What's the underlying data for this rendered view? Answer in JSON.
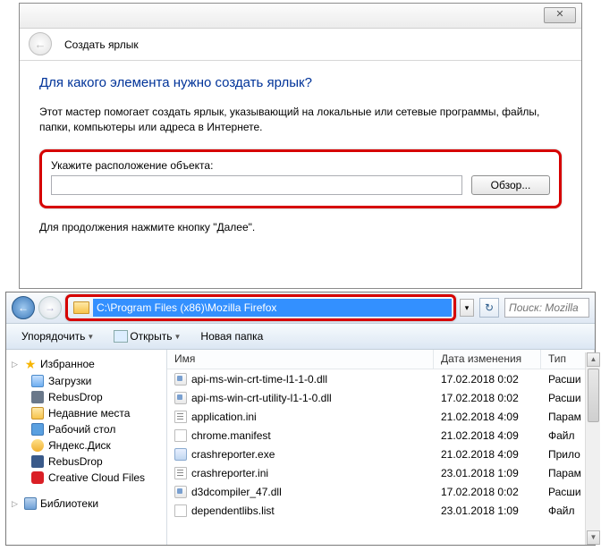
{
  "wizard": {
    "title": "Создать ярлык",
    "close": "✕",
    "question": "Для какого элемента нужно создать ярлык?",
    "description": "Этот мастер помогает создать ярлык, указывающий на локальные или сетевые программы, файлы, папки, компьютеры или адреса в Интернете.",
    "location_label": "Укажите расположение объекта:",
    "location_value": "",
    "browse": "Обзор...",
    "continue_hint": "Для продолжения нажмите кнопку \"Далее\"."
  },
  "explorer": {
    "address": "C:\\Program Files (x86)\\Mozilla Firefox",
    "search_placeholder": "Поиск: Mozilla",
    "toolbar": {
      "organize": "Упорядочить",
      "open": "Открыть",
      "new_folder": "Новая папка"
    },
    "sidebar": {
      "favorites": "Избранное",
      "items": [
        {
          "label": "Загрузки",
          "icon": "ic-dl"
        },
        {
          "label": "RebusDrop",
          "icon": "ic-rebus"
        },
        {
          "label": "Недавние места",
          "icon": "ic-recent"
        },
        {
          "label": "Рабочий стол",
          "icon": "ic-desk"
        },
        {
          "label": "Яндекс.Диск",
          "icon": "ic-yd"
        },
        {
          "label": "RebusDrop",
          "icon": "ic-rd"
        },
        {
          "label": "Creative Cloud Files",
          "icon": "ic-cc"
        }
      ],
      "libraries": "Библиотеки"
    },
    "columns": {
      "name": "Имя",
      "date": "Дата изменения",
      "type": "Тип"
    },
    "files": [
      {
        "name": "api-ms-win-crt-time-l1-1-0.dll",
        "date": "17.02.2018 0:02",
        "type": "Расши",
        "icon": "fic-dll"
      },
      {
        "name": "api-ms-win-crt-utility-l1-1-0.dll",
        "date": "17.02.2018 0:02",
        "type": "Расши",
        "icon": "fic-dll"
      },
      {
        "name": "application.ini",
        "date": "21.02.2018 4:09",
        "type": "Парам",
        "icon": "fic-ini"
      },
      {
        "name": "chrome.manifest",
        "date": "21.02.2018 4:09",
        "type": "Файл",
        "icon": "fic-man"
      },
      {
        "name": "crashreporter.exe",
        "date": "21.02.2018 4:09",
        "type": "Прило",
        "icon": "fic-exe"
      },
      {
        "name": "crashreporter.ini",
        "date": "23.01.2018 1:09",
        "type": "Парам",
        "icon": "fic-ini"
      },
      {
        "name": "d3dcompiler_47.dll",
        "date": "17.02.2018 0:02",
        "type": "Расши",
        "icon": "fic-dll"
      },
      {
        "name": "dependentlibs.list",
        "date": "23.01.2018 1:09",
        "type": "Файл",
        "icon": "fic-list"
      }
    ]
  }
}
